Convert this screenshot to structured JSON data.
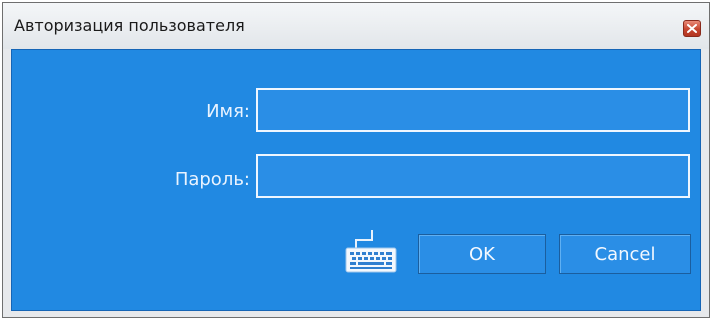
{
  "window": {
    "title": "Авторизация пользователя",
    "close_icon": "close-icon"
  },
  "form": {
    "username_label": "Имя:",
    "username_value": "",
    "password_label": "Пароль:",
    "password_value": ""
  },
  "actions": {
    "keyboard_icon": "keyboard-icon",
    "ok_label": "OK",
    "cancel_label": "Cancel"
  },
  "colors": {
    "panel_background": "#2189e2",
    "field_border": "#eef6ff",
    "close_button": "#c6452f"
  }
}
